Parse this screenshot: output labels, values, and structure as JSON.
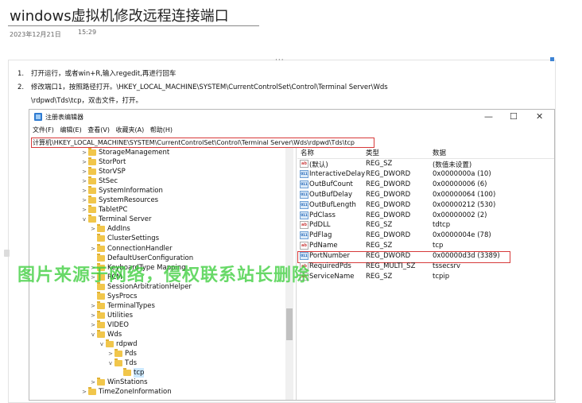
{
  "article": {
    "title": "windows虚拟机修改远程连接端口",
    "date": "2023年12月21日",
    "time": "15:29",
    "toolbar_handle": "···"
  },
  "steps": [
    {
      "num": "1.",
      "line1": "打开运行，或者win+R,输入regedit,再进行回车",
      "line2": ""
    },
    {
      "num": "2.",
      "line1": "修改端口1，按照路径打开。\\HKEY_LOCAL_MACHINE\\SYSTEM\\CurrentControlSet\\Control\\Terminal Server\\Wds",
      "line2": "\\rdpwd\\Tds\\tcp，双击文件，打开。"
    }
  ],
  "regedit": {
    "title": "注册表编辑器",
    "window_buttons": {
      "minimize": "—",
      "maximize": "☐",
      "close": "✕"
    },
    "menu": [
      "文件(F)",
      "编辑(E)",
      "查看(V)",
      "收藏夹(A)",
      "帮助(H)"
    ],
    "address": "计算机\\HKEY_LOCAL_MACHINE\\SYSTEM\\CurrentControlSet\\Control\\Terminal Server\\Wds\\rdpwd\\Tds\\tcp",
    "tree": [
      {
        "label": "StorageManagement",
        "depth": 0,
        "expander": ">"
      },
      {
        "label": "StorPort",
        "depth": 0,
        "expander": ">"
      },
      {
        "label": "StorVSP",
        "depth": 0,
        "expander": ">"
      },
      {
        "label": "StSec",
        "depth": 0,
        "expander": ">"
      },
      {
        "label": "SystemInformation",
        "depth": 0,
        "expander": ">"
      },
      {
        "label": "SystemResources",
        "depth": 0,
        "expander": ">"
      },
      {
        "label": "TabletPC",
        "depth": 0,
        "expander": ">"
      },
      {
        "label": "Terminal Server",
        "depth": 0,
        "expander": "v"
      },
      {
        "label": "AddIns",
        "depth": 1,
        "expander": ">"
      },
      {
        "label": "ClusterSettings",
        "depth": 1,
        "expander": ""
      },
      {
        "label": "ConnectionHandler",
        "depth": 1,
        "expander": ">"
      },
      {
        "label": "DefaultUserConfiguration",
        "depth": 1,
        "expander": ""
      },
      {
        "label": "KeyboardType Mapping",
        "depth": 1,
        "expander": ">"
      },
      {
        "label": "RCM",
        "depth": 1,
        "expander": ">"
      },
      {
        "label": "SessionArbitrationHelper",
        "depth": 1,
        "expander": ""
      },
      {
        "label": "SysProcs",
        "depth": 1,
        "expander": ""
      },
      {
        "label": "TerminalTypes",
        "depth": 1,
        "expander": ">"
      },
      {
        "label": "Utilities",
        "depth": 1,
        "expander": ">"
      },
      {
        "label": "VIDEO",
        "depth": 1,
        "expander": ">"
      },
      {
        "label": "Wds",
        "depth": 1,
        "expander": "v"
      },
      {
        "label": "rdpwd",
        "depth": 2,
        "expander": "v"
      },
      {
        "label": "Pds",
        "depth": 3,
        "expander": ">"
      },
      {
        "label": "Tds",
        "depth": 3,
        "expander": "v"
      },
      {
        "label": "tcp",
        "depth": 4,
        "expander": "",
        "selected": true
      },
      {
        "label": "WinStations",
        "depth": 1,
        "expander": ">"
      },
      {
        "label": "TimeZoneInformation",
        "depth": 0,
        "expander": ">"
      }
    ],
    "columns": [
      "名称",
      "类型",
      "数据"
    ],
    "values": [
      {
        "name": "(默认)",
        "type": "REG_SZ",
        "data": "(数值未设置)",
        "kind": "sz"
      },
      {
        "name": "InteractiveDelay",
        "type": "REG_DWORD",
        "data": "0x0000000a (10)",
        "kind": "bin"
      },
      {
        "name": "OutBufCount",
        "type": "REG_DWORD",
        "data": "0x00000006 (6)",
        "kind": "bin"
      },
      {
        "name": "OutBufDelay",
        "type": "REG_DWORD",
        "data": "0x00000064 (100)",
        "kind": "bin"
      },
      {
        "name": "OutBufLength",
        "type": "REG_DWORD",
        "data": "0x00000212 (530)",
        "kind": "bin"
      },
      {
        "name": "PdClass",
        "type": "REG_DWORD",
        "data": "0x00000002 (2)",
        "kind": "bin"
      },
      {
        "name": "PdDLL",
        "type": "REG_SZ",
        "data": "tdtcp",
        "kind": "sz"
      },
      {
        "name": "PdFlag",
        "type": "REG_DWORD",
        "data": "0x0000004e (78)",
        "kind": "bin"
      },
      {
        "name": "PdName",
        "type": "REG_SZ",
        "data": "tcp",
        "kind": "sz"
      },
      {
        "name": "PortNumber",
        "type": "REG_DWORD",
        "data": "0x00000d3d (3389)",
        "kind": "bin",
        "highlighted": true
      },
      {
        "name": "RequiredPds",
        "type": "REG_MULTI_SZ",
        "data": "tssecsrv",
        "kind": "sz"
      },
      {
        "name": "ServiceName",
        "type": "REG_SZ",
        "data": "tcpip",
        "kind": "sz"
      }
    ]
  },
  "watermark": "图片来源于网络，侵权联系站长删除",
  "colors": {
    "highlight_border": "#d73a3a",
    "watermark": "#3ecf3e",
    "folder": "#f1c64b"
  }
}
